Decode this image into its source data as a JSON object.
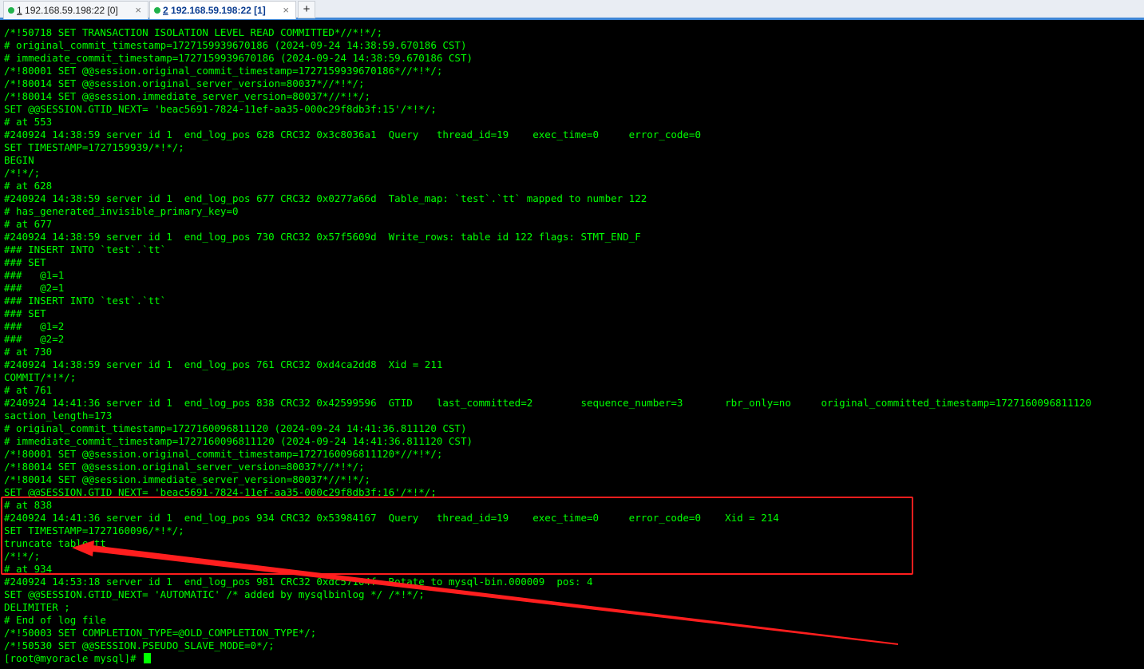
{
  "tabs": [
    {
      "number": "1",
      "title": "192.168.59.198:22 [0]",
      "active": false,
      "close": "×"
    },
    {
      "number": "2",
      "title": "192.168.59.198:22 [1]",
      "active": true,
      "close": "×"
    }
  ],
  "new_tab_label": "+",
  "colors": {
    "terminal_bg": "#000000",
    "terminal_fg": "#00ff00",
    "annotation": "#ff1e1e",
    "tab_active_dot": "#21b24b"
  },
  "terminal": {
    "lines": [
      "/*!50718 SET TRANSACTION ISOLATION LEVEL READ COMMITTED*//*!*/;",
      "# original_commit_timestamp=1727159939670186 (2024-09-24 14:38:59.670186 CST)",
      "# immediate_commit_timestamp=1727159939670186 (2024-09-24 14:38:59.670186 CST)",
      "/*!80001 SET @@session.original_commit_timestamp=1727159939670186*//*!*/;",
      "/*!80014 SET @@session.original_server_version=80037*//*!*/;",
      "/*!80014 SET @@session.immediate_server_version=80037*//*!*/;",
      "SET @@SESSION.GTID_NEXT= 'beac5691-7824-11ef-aa35-000c29f8db3f:15'/*!*/;",
      "# at 553",
      "#240924 14:38:59 server id 1  end_log_pos 628 CRC32 0x3c8036a1  Query   thread_id=19    exec_time=0     error_code=0",
      "SET TIMESTAMP=1727159939/*!*/;",
      "BEGIN",
      "/*!*/;",
      "# at 628",
      "#240924 14:38:59 server id 1  end_log_pos 677 CRC32 0x0277a66d  Table_map: `test`.`tt` mapped to number 122",
      "# has_generated_invisible_primary_key=0",
      "# at 677",
      "#240924 14:38:59 server id 1  end_log_pos 730 CRC32 0x57f5609d  Write_rows: table id 122 flags: STMT_END_F",
      "### INSERT INTO `test`.`tt`",
      "### SET",
      "###   @1=1",
      "###   @2=1",
      "### INSERT INTO `test`.`tt`",
      "### SET",
      "###   @1=2",
      "###   @2=2",
      "# at 730",
      "#240924 14:38:59 server id 1  end_log_pos 761 CRC32 0xd4ca2dd8  Xid = 211",
      "COMMIT/*!*/;",
      "# at 761",
      "#240924 14:41:36 server id 1  end_log_pos 838 CRC32 0x42599596  GTID    last_committed=2        sequence_number=3       rbr_only=no     original_committed_timestamp=1727160096811120",
      "saction_length=173",
      "# original_commit_timestamp=1727160096811120 (2024-09-24 14:41:36.811120 CST)",
      "# immediate_commit_timestamp=1727160096811120 (2024-09-24 14:41:36.811120 CST)",
      "/*!80001 SET @@session.original_commit_timestamp=1727160096811120*//*!*/;",
      "/*!80014 SET @@session.original_server_version=80037*//*!*/;",
      "/*!80014 SET @@session.immediate_server_version=80037*//*!*/;",
      "SET @@SESSION.GTID_NEXT= 'beac5691-7824-11ef-aa35-000c29f8db3f:16'/*!*/;",
      "# at 838",
      "#240924 14:41:36 server id 1  end_log_pos 934 CRC32 0x53984167  Query   thread_id=19    exec_time=0     error_code=0    Xid = 214",
      "SET TIMESTAMP=1727160096/*!*/;",
      "truncate table tt",
      "/*!*/;",
      "# at 934",
      "#240924 14:53:18 server id 1  end_log_pos 981 CRC32 0xdc57104f  Rotate to mysql-bin.000009  pos: 4",
      "SET @@SESSION.GTID_NEXT= 'AUTOMATIC' /* added by mysqlbinlog */ /*!*/;",
      "DELIMITER ;",
      "# End of log file",
      "/*!50003 SET COMPLETION_TYPE=@OLD_COMPLETION_TYPE*/;",
      "/*!50530 SET @@SESSION.PSEUDO_SLAVE_MODE=0*/;"
    ],
    "prompt": "[root@myoracle mysql]# "
  }
}
